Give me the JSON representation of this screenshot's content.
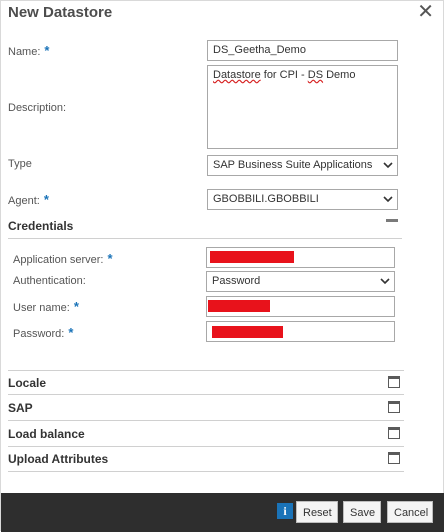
{
  "dialog": {
    "title": "New Datastore",
    "close_glyph": "✕"
  },
  "form": {
    "name": {
      "label": "Name:",
      "required": "*",
      "value": "DS_Geetha_Demo"
    },
    "description": {
      "label": "Description:",
      "value_part1": "Datastore",
      "value_part2": " for CPI - ",
      "value_part3": "DS",
      "value_part4": " Demo"
    },
    "type": {
      "label": "Type",
      "value": "SAP Business Suite Applications"
    },
    "agent": {
      "label": "Agent:",
      "required": "*",
      "value": "GBOBBILI.GBOBBILI"
    }
  },
  "credentials": {
    "title": "Credentials",
    "application_server": {
      "label": "Application server:",
      "required": "*",
      "value_redacted": true
    },
    "authentication": {
      "label": "Authentication:",
      "value": "Password"
    },
    "user_name": {
      "label": "User name:",
      "required": "*",
      "value_redacted": true
    },
    "password": {
      "label": "Password:",
      "required": "*",
      "value_redacted": true
    }
  },
  "sections": [
    {
      "title": "Locale",
      "icon": "expand-box-icon"
    },
    {
      "title": "SAP",
      "icon": "expand-box-icon"
    },
    {
      "title": "Load balance",
      "icon": "expand-box-icon"
    },
    {
      "title": "Upload Attributes",
      "icon": "expand-box-icon"
    }
  ],
  "footer": {
    "info_glyph": "i",
    "reset_label": "Reset",
    "save_label": "Save",
    "cancel_label": "Cancel"
  },
  "colors": {
    "accent": "#1a73b8",
    "redaction": "#e8121b",
    "footer_bg": "#2e2e2e"
  }
}
